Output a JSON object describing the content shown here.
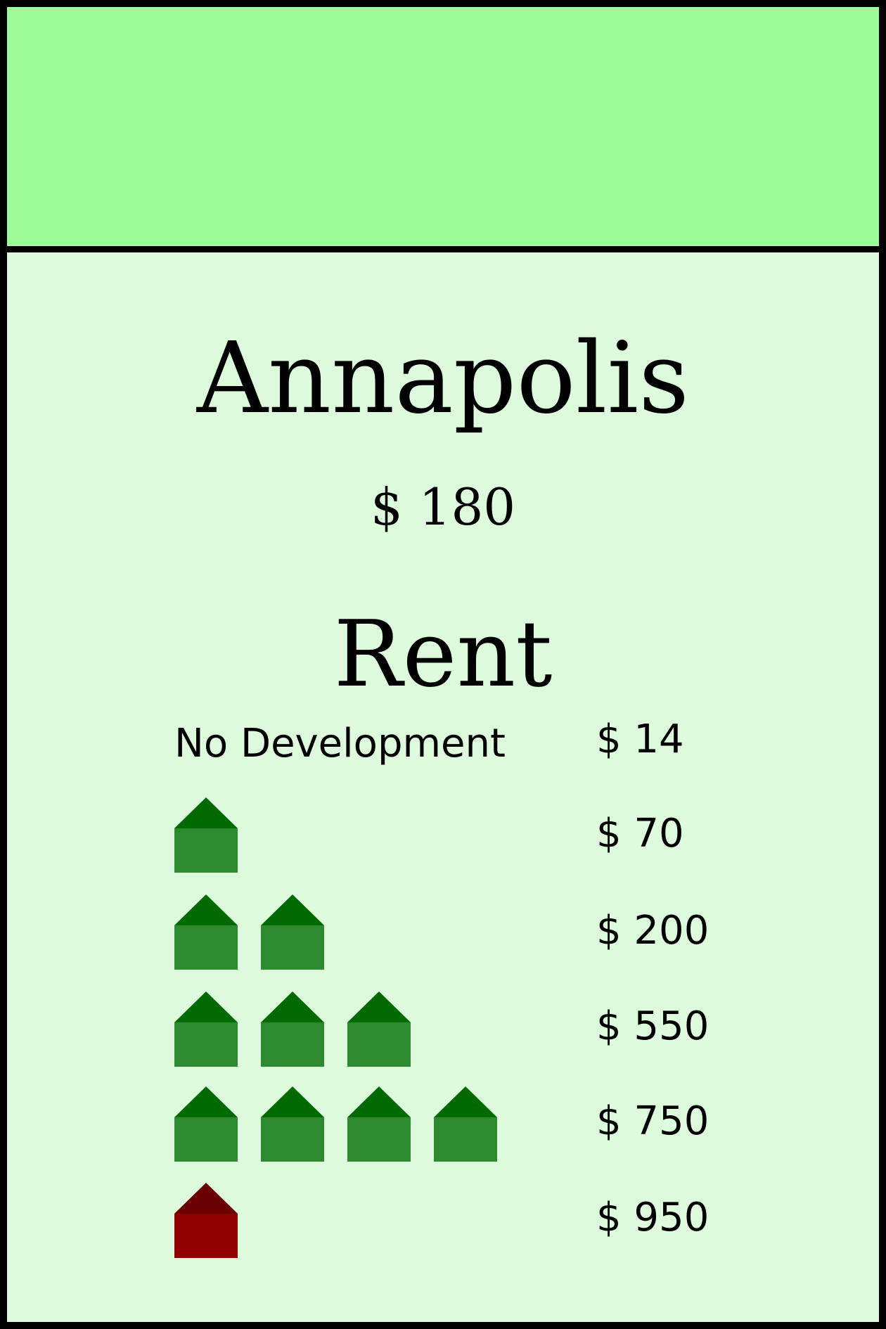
{
  "property": {
    "name": "Annapolis",
    "price": "$ 180",
    "group_color": "#9ffd99",
    "card_background": "#ddfadc"
  },
  "rent": {
    "heading": "Rent",
    "rows": [
      {
        "label": "No Development",
        "value": "$ 14",
        "houses": 0,
        "hotel": false
      },
      {
        "label": "",
        "value": "$ 70",
        "houses": 1,
        "hotel": false
      },
      {
        "label": "",
        "value": "$ 200",
        "houses": 2,
        "hotel": false
      },
      {
        "label": "",
        "value": "$ 550",
        "houses": 3,
        "hotel": false
      },
      {
        "label": "",
        "value": "$ 750",
        "houses": 4,
        "hotel": false
      },
      {
        "label": "",
        "value": "$ 950",
        "houses": 0,
        "hotel": true
      }
    ]
  },
  "icons": {
    "house": "house-icon",
    "hotel": "hotel-icon",
    "house_colors": {
      "roof": "#006a00",
      "body": "#2e8a2e"
    },
    "hotel_colors": {
      "roof": "#6a0000",
      "body": "#900000"
    }
  }
}
